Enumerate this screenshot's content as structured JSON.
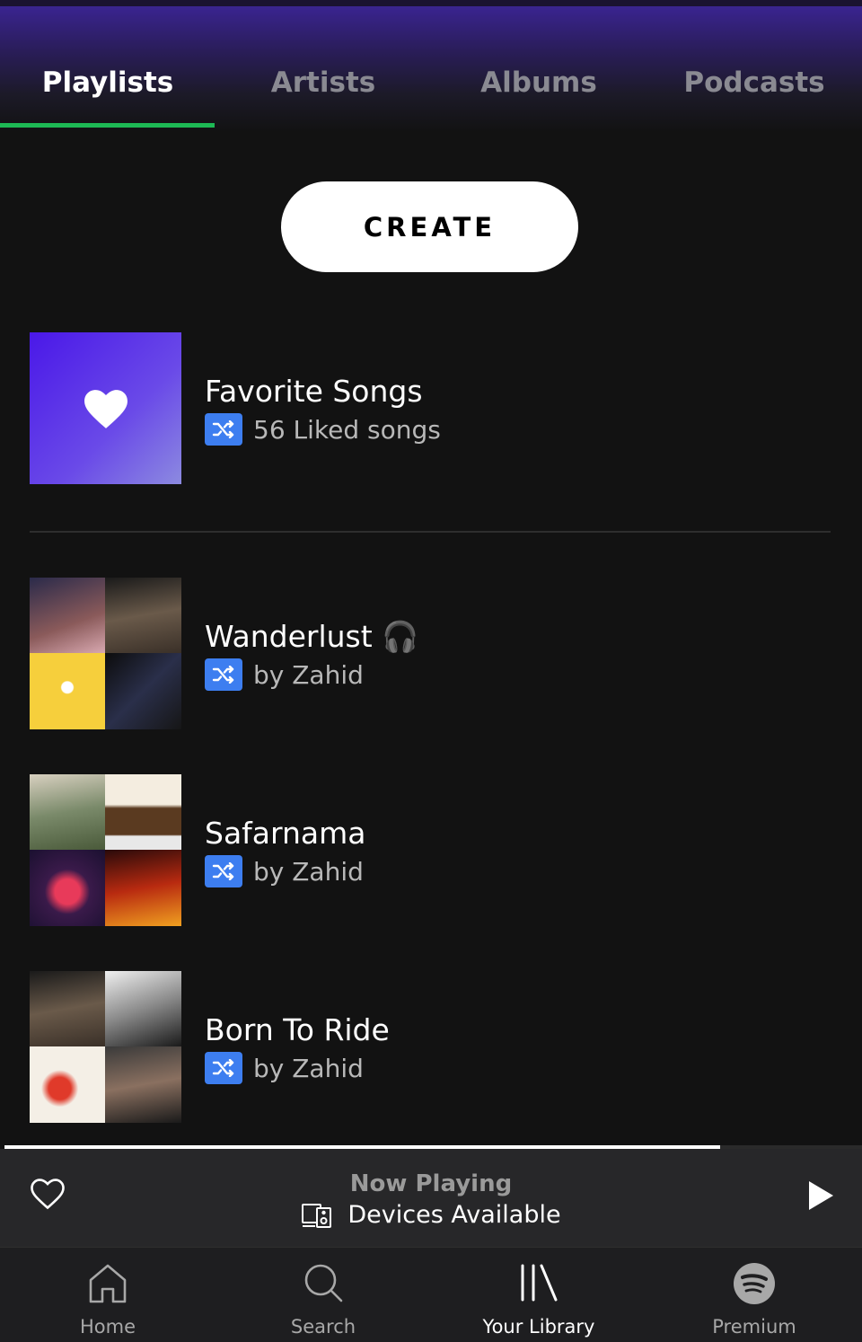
{
  "tabs": [
    {
      "label": "Playlists",
      "active": true
    },
    {
      "label": "Artists",
      "active": false
    },
    {
      "label": "Albums",
      "active": false
    },
    {
      "label": "Podcasts",
      "active": false
    }
  ],
  "create_button": {
    "label": "CREATE"
  },
  "playlists": [
    {
      "title": "Favorite Songs",
      "subtitle": "56 Liked songs",
      "cover": "heart-icon"
    },
    {
      "title": "Wanderlust 🎧",
      "subtitle": "by Zahid",
      "cover": "album-mosaic"
    },
    {
      "title": "Safarnama",
      "subtitle": "by Zahid",
      "cover": "album-mosaic"
    },
    {
      "title": "Born To Ride",
      "subtitle": "by Zahid",
      "cover": "album-mosaic"
    }
  ],
  "now_playing": {
    "title": "Now Playing",
    "devices_label": "Devices Available",
    "progress": 0.835
  },
  "bottom_nav": [
    {
      "label": "Home",
      "icon": "home-icon",
      "active": false
    },
    {
      "label": "Search",
      "icon": "search-icon",
      "active": false
    },
    {
      "label": "Your Library",
      "icon": "library-icon",
      "active": true
    },
    {
      "label": "Premium",
      "icon": "spotify-icon",
      "active": false
    }
  ],
  "colors": {
    "accent": "#1db954",
    "background": "#121212",
    "shuffle_badge": "#3d7ef0"
  }
}
